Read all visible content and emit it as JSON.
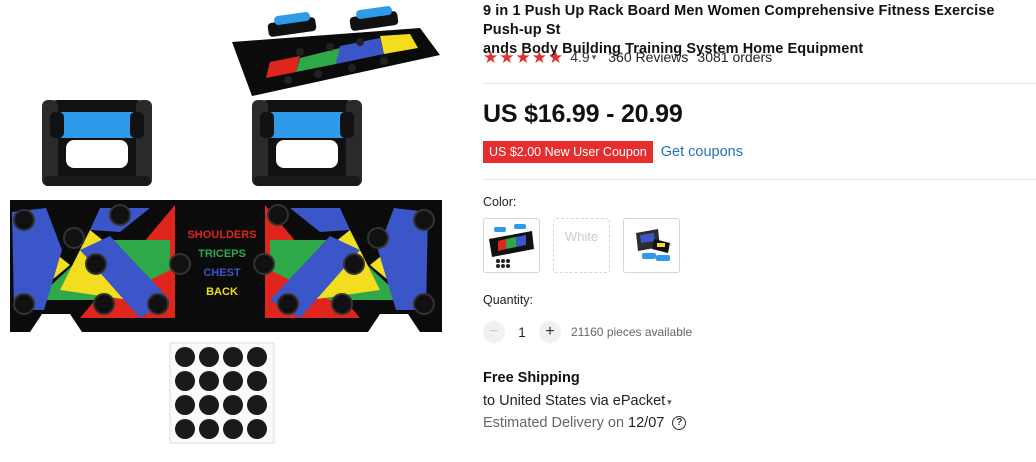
{
  "product": {
    "title_line1": "9 in 1 Push Up Rack Board Men Women Comprehensive Fitness Exercise Push-up St",
    "title_line2": "ands Body Building Training System Home Equipment",
    "rating": {
      "stars_filled": 5,
      "value": "4.9",
      "reviews": "360 Reviews",
      "orders": "3081 orders",
      "star_color": "#e62e2e"
    },
    "price": "US $16.99 - 20.99",
    "coupon": {
      "badge": "US $2.00 New User Coupon",
      "link": "Get coupons",
      "badge_color": "#e62e2e",
      "link_color": "#2472b7"
    },
    "image_labels": {
      "shoulders": "SHOULDERS",
      "triceps": "TRICEPS",
      "chest": "CHEST",
      "back": "BACK"
    },
    "board_colors": {
      "red": "#e0261c",
      "green": "#2fa84a",
      "blue": "#3a56c8",
      "yellow": "#f2dd1f",
      "handle_blue": "#2d9bea"
    }
  },
  "options": {
    "color_label": "Color:",
    "swatches": [
      {
        "name": "board-set",
        "icon": "pushup-board-thumbnail",
        "selected": false
      },
      {
        "name": "white",
        "text": "White",
        "available": false
      },
      {
        "name": "board-box",
        "icon": "pushup-box-thumbnail",
        "selected": false
      }
    ]
  },
  "quantity": {
    "label": "Quantity:",
    "value": "1",
    "decrement_icon": "minus-icon",
    "increment_icon": "plus-icon",
    "available": "21160 pieces available"
  },
  "shipping": {
    "title": "Free Shipping",
    "method": "to United States via ePacket",
    "delivery_label": "Estimated Delivery on",
    "delivery_date": "12/07"
  }
}
